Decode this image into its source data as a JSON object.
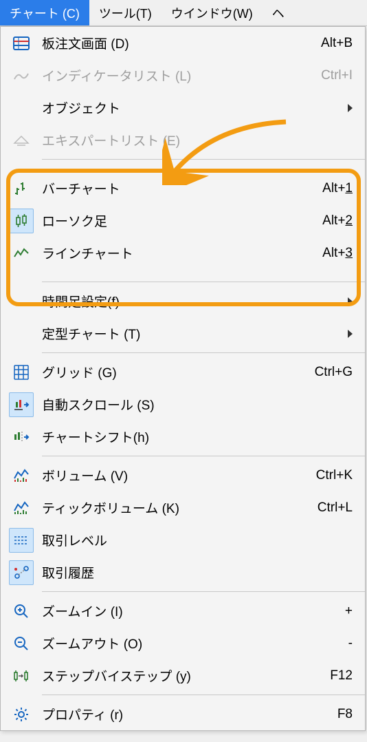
{
  "menubar": {
    "chart": "チャート (C)",
    "tool": "ツール(T)",
    "window": "ウインドウ(W)",
    "help": "ヘ"
  },
  "menu": {
    "dom": {
      "label": "板注文画面 (D)",
      "shortcut": "Alt+B"
    },
    "indicator": {
      "label": "インディケータリスト (L)",
      "shortcut": "Ctrl+I"
    },
    "objects": {
      "label": "オブジェクト"
    },
    "experts": {
      "label": "エキスパートリスト (E)"
    },
    "bar": {
      "label": "バーチャート",
      "shortcut": "Alt+",
      "shortcut_key": "1"
    },
    "candle": {
      "label": "ローソク足",
      "shortcut": "Alt+",
      "shortcut_key": "2"
    },
    "line": {
      "label": "ラインチャート",
      "shortcut": "Alt+",
      "shortcut_key": "3"
    },
    "timeframe": {
      "label": "時間足設定(f)"
    },
    "template": {
      "label": "定型チャート (T)"
    },
    "grid": {
      "label": "グリッド (G)",
      "shortcut": "Ctrl+G"
    },
    "autoscroll": {
      "label": "自動スクロール (S)"
    },
    "chartshift": {
      "label": "チャートシフト(h)"
    },
    "volume": {
      "label": "ボリューム (V)",
      "shortcut": "Ctrl+K"
    },
    "tickvolume": {
      "label": "ティックボリューム (K)",
      "shortcut": "Ctrl+L"
    },
    "tradelevel": {
      "label": "取引レベル"
    },
    "tradehistory": {
      "label": "取引履歴"
    },
    "zoomin": {
      "label": "ズームイン (I)",
      "shortcut": "+"
    },
    "zoomout": {
      "label": "ズームアウト (O)",
      "shortcut": "-"
    },
    "stepbystep": {
      "label": "ステップバイステップ (y)",
      "shortcut": "F12"
    },
    "properties": {
      "label": "プロパティ (r)",
      "shortcut": "F8"
    }
  }
}
